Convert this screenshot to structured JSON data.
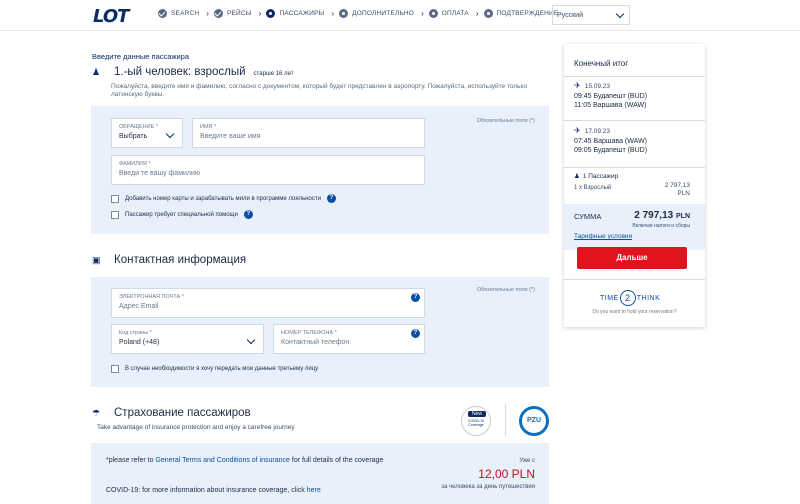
{
  "header": {
    "logo": "LOT",
    "steps": [
      {
        "label": "SEARCH",
        "state": "done"
      },
      {
        "label": "РЕЙСЫ",
        "state": "done"
      },
      {
        "label": "ПАССАЖИРЫ",
        "state": "active"
      },
      {
        "label": "ДОПОЛНИТЕЛЬНО",
        "state": "todo"
      },
      {
        "label": "ОПЛАТА",
        "state": "todo"
      },
      {
        "label": "ПОДТВЕРЖДЕНИЕ",
        "state": "todo"
      }
    ],
    "language": "Русский"
  },
  "passenger": {
    "form_title": "Введите данные пассажира",
    "heading": "1.-ый человек: взрослый",
    "age_note": "старше 16 лет",
    "hint": "Пожалуйста, введите имя и фамилию, согласно с документом, который будет представлен в аэропорту. Пожалуйста, используйте только латинскую буквы.",
    "required_note": "Обязательные поля (*)",
    "title_field": {
      "label": "ОБРАЩЕНИЕ *",
      "value": "Выбрать"
    },
    "first_name": {
      "label": "ИМЯ *",
      "placeholder": "Введите ваше имя"
    },
    "last_name": {
      "label": "ФАМИЛИЯ *",
      "placeholder": "Введи те вашу фамилию"
    },
    "loyalty_checkbox": "Добавить номер карты и зарабатывать мили в программе лояльности",
    "assistance_checkbox": "Пассажир требует специальной помощи"
  },
  "contact": {
    "heading": "Контактная информация",
    "required_note": "Обязательные поля (*)",
    "email": {
      "label": "ЭЛЕКТРОННАЯ ПОЧТА *",
      "placeholder": "Адрес Email"
    },
    "country_code": {
      "label": "Код страны *",
      "value": "Poland (+48)"
    },
    "phone": {
      "label": "НОМЕР ТЕЛЕФОНА *",
      "placeholder": "Контактный телефон"
    },
    "share_checkbox": "В случае необходимости я хочу передать мои данные третьему лицу"
  },
  "insurance": {
    "heading": "Страхование пассажиров",
    "subtitle": "Take advantage of insurance protection and enjoy a carefree journey",
    "badge_new": "New",
    "badge_text": "COVID-19 Coverage",
    "partner": "PZU",
    "text1_pre": "*please refer to ",
    "text1_link": "General Terms and Conditions of insurance",
    "text1_post": " for full details of the coverage",
    "text2_pre": "COVID-19: for more information about insurance coverage, click ",
    "text2_link": "here",
    "price_label": "Уже с",
    "price": "12,00 PLN",
    "price_note": "за человека за день путешествия"
  },
  "summary": {
    "title": "Конечный итог",
    "flights": [
      {
        "date": "15.09.23",
        "dep": "09:45 Будапешт (BUD)",
        "arr": "11:05 Варшава (WAW)"
      },
      {
        "date": "17.09.23",
        "dep": "07:45 Варшава (WAW)",
        "arr": "09:05 Будапешт (BUD)"
      }
    ],
    "pax_count": "1 Пассажир",
    "pax_type": "1 x Взрослый",
    "pax_amount": "2 797,13",
    "pax_currency": "PLN",
    "total_label": "СУММА",
    "total_amount": "2 797,13",
    "total_currency": "PLN",
    "total_note": "Включая налоги и сборы",
    "tariff_link": "Тарифные условия",
    "next_button": "Дальше",
    "t2t_pre": "TIME",
    "t2t_mid": "2",
    "t2t_post": "THINK",
    "t2t_sub": "Do you want to hold your reservation?"
  },
  "colors": {
    "brand": "#0b2b63",
    "accent_red": "#e0141e",
    "panel_bg": "#e8f1fb"
  }
}
